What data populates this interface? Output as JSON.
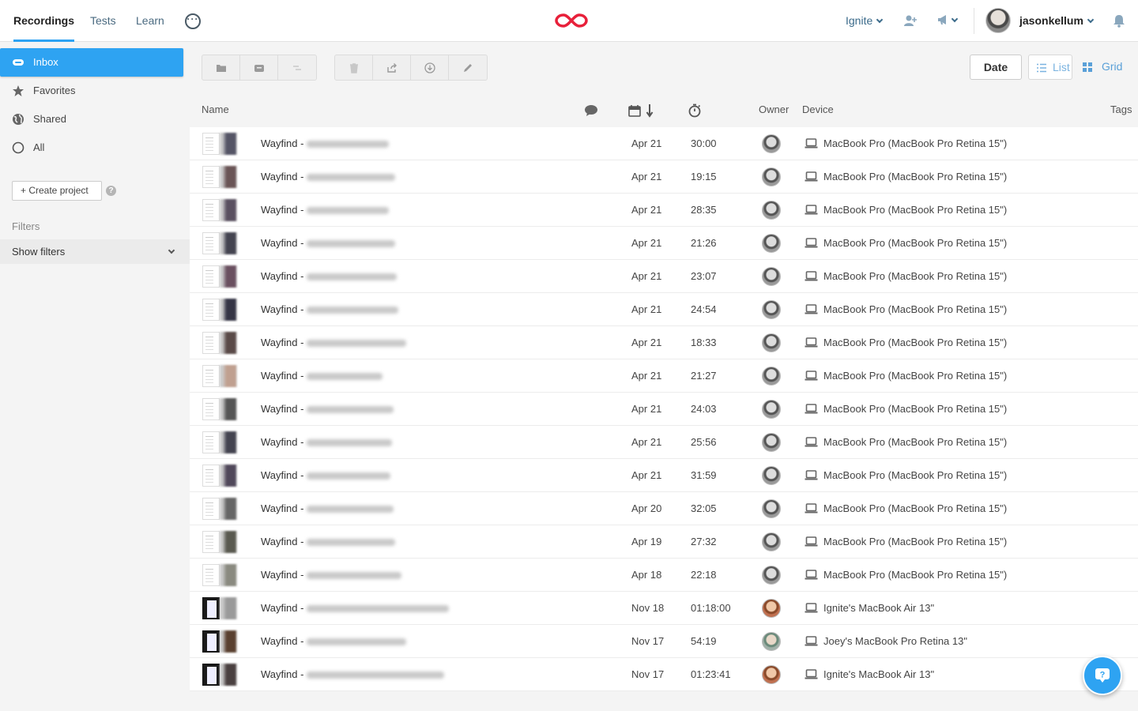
{
  "nav": {
    "tabs": [
      {
        "label": "Recordings",
        "active": true
      },
      {
        "label": "Tests",
        "active": false
      },
      {
        "label": "Learn",
        "active": false
      }
    ],
    "more_icon": "more-icon"
  },
  "header": {
    "team": "Ignite",
    "username": "jasonkellum",
    "accent_color": "#2ea3f2",
    "logo_color": "#e8203a"
  },
  "sidebar": {
    "items": [
      {
        "label": "Inbox",
        "icon": "inbox-icon",
        "active": true
      },
      {
        "label": "Favorites",
        "icon": "star-icon",
        "active": false
      },
      {
        "label": "Shared",
        "icon": "globe-icon",
        "active": false
      },
      {
        "label": "All",
        "icon": "circle-icon",
        "active": false
      }
    ],
    "create_project": "+ Create project",
    "filters_label": "Filters",
    "show_filters": "Show filters"
  },
  "toolbar": {
    "sort_label": "Date",
    "list_label": "List",
    "grid_label": "Grid"
  },
  "table": {
    "headers": {
      "name": "Name",
      "owner": "Owner",
      "device": "Device",
      "tags": "Tags"
    },
    "rows": [
      {
        "name": "Wayfind -",
        "date": "Apr 21",
        "duration": "30:00",
        "owner": "jasonkellum",
        "device": "MacBook Pro (MacBook Pro Retina 15\")",
        "thumb": "light"
      },
      {
        "name": "Wayfind -",
        "date": "Apr 21",
        "duration": "19:15",
        "owner": "jasonkellum",
        "device": "MacBook Pro (MacBook Pro Retina 15\")",
        "thumb": "light"
      },
      {
        "name": "Wayfind -",
        "date": "Apr 21",
        "duration": "28:35",
        "owner": "jasonkellum",
        "device": "MacBook Pro (MacBook Pro Retina 15\")",
        "thumb": "light"
      },
      {
        "name": "Wayfind -",
        "date": "Apr 21",
        "duration": "21:26",
        "owner": "jasonkellum",
        "device": "MacBook Pro (MacBook Pro Retina 15\")",
        "thumb": "light"
      },
      {
        "name": "Wayfind -",
        "date": "Apr 21",
        "duration": "23:07",
        "owner": "jasonkellum",
        "device": "MacBook Pro (MacBook Pro Retina 15\")",
        "thumb": "light"
      },
      {
        "name": "Wayfind -",
        "date": "Apr 21",
        "duration": "24:54",
        "owner": "jasonkellum",
        "device": "MacBook Pro (MacBook Pro Retina 15\")",
        "thumb": "light"
      },
      {
        "name": "Wayfind -",
        "date": "Apr 21",
        "duration": "18:33",
        "owner": "jasonkellum",
        "device": "MacBook Pro (MacBook Pro Retina 15\")",
        "thumb": "light"
      },
      {
        "name": "Wayfind -",
        "date": "Apr 21",
        "duration": "21:27",
        "owner": "jasonkellum",
        "device": "MacBook Pro (MacBook Pro Retina 15\")",
        "thumb": "light"
      },
      {
        "name": "Wayfind -",
        "date": "Apr 21",
        "duration": "24:03",
        "owner": "jasonkellum",
        "device": "MacBook Pro (MacBook Pro Retina 15\")",
        "thumb": "light"
      },
      {
        "name": "Wayfind -",
        "date": "Apr 21",
        "duration": "25:56",
        "owner": "jasonkellum",
        "device": "MacBook Pro (MacBook Pro Retina 15\")",
        "thumb": "light"
      },
      {
        "name": "Wayfind -",
        "date": "Apr 21",
        "duration": "31:59",
        "owner": "jasonkellum",
        "device": "MacBook Pro (MacBook Pro Retina 15\")",
        "thumb": "light"
      },
      {
        "name": "Wayfind -",
        "date": "Apr 20",
        "duration": "32:05",
        "owner": "jasonkellum",
        "device": "MacBook Pro (MacBook Pro Retina 15\")",
        "thumb": "light"
      },
      {
        "name": "Wayfind -",
        "date": "Apr 19",
        "duration": "27:32",
        "owner": "jasonkellum",
        "device": "MacBook Pro (MacBook Pro Retina 15\")",
        "thumb": "light"
      },
      {
        "name": "Wayfind -",
        "date": "Apr 18",
        "duration": "22:18",
        "owner": "jasonkellum",
        "device": "MacBook Pro (MacBook Pro Retina 15\")",
        "thumb": "light"
      },
      {
        "name": "Wayfind -",
        "date": "Nov 18",
        "duration": "01:18:00",
        "owner": "other-1",
        "device": "Ignite's MacBook Air 13\"",
        "thumb": "dark"
      },
      {
        "name": "Wayfind -",
        "date": "Nov 17",
        "duration": "54:19",
        "owner": "other-2",
        "device": "Joey's MacBook Pro Retina 13\"",
        "thumb": "dark"
      },
      {
        "name": "Wayfind -",
        "date": "Nov 17",
        "duration": "01:23:41",
        "owner": "other-1",
        "device": "Ignite's MacBook Air 13\"",
        "thumb": "dark"
      }
    ]
  }
}
